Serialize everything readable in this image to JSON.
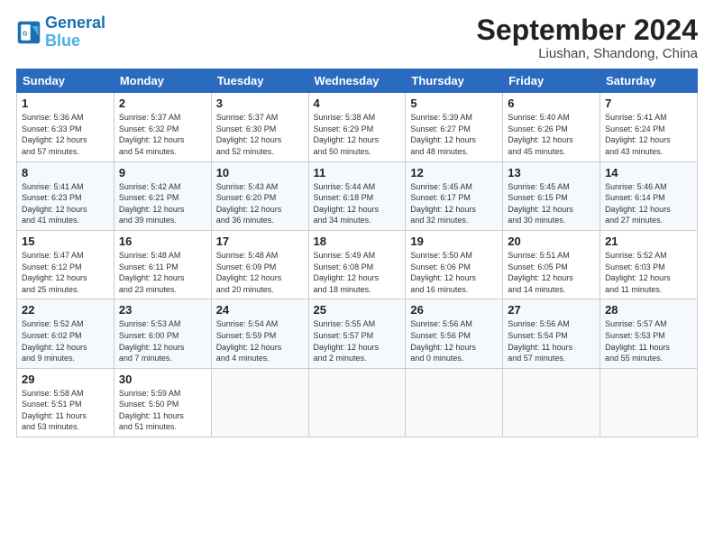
{
  "logo": {
    "line1": "General",
    "line2": "Blue"
  },
  "title": "September 2024",
  "location": "Liushan, Shandong, China",
  "days_of_week": [
    "Sunday",
    "Monday",
    "Tuesday",
    "Wednesday",
    "Thursday",
    "Friday",
    "Saturday"
  ],
  "weeks": [
    [
      {
        "num": "1",
        "rise": "5:36 AM",
        "set": "6:33 PM",
        "hours": "12 hours",
        "mins": "57"
      },
      {
        "num": "2",
        "rise": "5:37 AM",
        "set": "6:32 PM",
        "hours": "12 hours",
        "mins": "54"
      },
      {
        "num": "3",
        "rise": "5:37 AM",
        "set": "6:30 PM",
        "hours": "12 hours",
        "mins": "52"
      },
      {
        "num": "4",
        "rise": "5:38 AM",
        "set": "6:29 PM",
        "hours": "12 hours",
        "mins": "50"
      },
      {
        "num": "5",
        "rise": "5:39 AM",
        "set": "6:27 PM",
        "hours": "12 hours",
        "mins": "48"
      },
      {
        "num": "6",
        "rise": "5:40 AM",
        "set": "6:26 PM",
        "hours": "12 hours",
        "mins": "45"
      },
      {
        "num": "7",
        "rise": "5:41 AM",
        "set": "6:24 PM",
        "hours": "12 hours",
        "mins": "43"
      }
    ],
    [
      {
        "num": "8",
        "rise": "5:41 AM",
        "set": "6:23 PM",
        "hours": "12 hours",
        "mins": "41"
      },
      {
        "num": "9",
        "rise": "5:42 AM",
        "set": "6:21 PM",
        "hours": "12 hours",
        "mins": "39"
      },
      {
        "num": "10",
        "rise": "5:43 AM",
        "set": "6:20 PM",
        "hours": "12 hours",
        "mins": "36"
      },
      {
        "num": "11",
        "rise": "5:44 AM",
        "set": "6:18 PM",
        "hours": "12 hours",
        "mins": "34"
      },
      {
        "num": "12",
        "rise": "5:45 AM",
        "set": "6:17 PM",
        "hours": "12 hours",
        "mins": "32"
      },
      {
        "num": "13",
        "rise": "5:45 AM",
        "set": "6:15 PM",
        "hours": "12 hours",
        "mins": "30"
      },
      {
        "num": "14",
        "rise": "5:46 AM",
        "set": "6:14 PM",
        "hours": "12 hours",
        "mins": "27"
      }
    ],
    [
      {
        "num": "15",
        "rise": "5:47 AM",
        "set": "6:12 PM",
        "hours": "12 hours",
        "mins": "25"
      },
      {
        "num": "16",
        "rise": "5:48 AM",
        "set": "6:11 PM",
        "hours": "12 hours",
        "mins": "23"
      },
      {
        "num": "17",
        "rise": "5:48 AM",
        "set": "6:09 PM",
        "hours": "12 hours",
        "mins": "20"
      },
      {
        "num": "18",
        "rise": "5:49 AM",
        "set": "6:08 PM",
        "hours": "12 hours",
        "mins": "18"
      },
      {
        "num": "19",
        "rise": "5:50 AM",
        "set": "6:06 PM",
        "hours": "12 hours",
        "mins": "16"
      },
      {
        "num": "20",
        "rise": "5:51 AM",
        "set": "6:05 PM",
        "hours": "12 hours",
        "mins": "14"
      },
      {
        "num": "21",
        "rise": "5:52 AM",
        "set": "6:03 PM",
        "hours": "12 hours",
        "mins": "11"
      }
    ],
    [
      {
        "num": "22",
        "rise": "5:52 AM",
        "set": "6:02 PM",
        "hours": "12 hours",
        "mins": "9"
      },
      {
        "num": "23",
        "rise": "5:53 AM",
        "set": "6:00 PM",
        "hours": "12 hours",
        "mins": "7"
      },
      {
        "num": "24",
        "rise": "5:54 AM",
        "set": "5:59 PM",
        "hours": "12 hours",
        "mins": "4"
      },
      {
        "num": "25",
        "rise": "5:55 AM",
        "set": "5:57 PM",
        "hours": "12 hours",
        "mins": "2"
      },
      {
        "num": "26",
        "rise": "5:56 AM",
        "set": "5:56 PM",
        "hours": "12 hours",
        "mins": "0"
      },
      {
        "num": "27",
        "rise": "5:56 AM",
        "set": "5:54 PM",
        "hours": "11 hours",
        "mins": "57"
      },
      {
        "num": "28",
        "rise": "5:57 AM",
        "set": "5:53 PM",
        "hours": "11 hours",
        "mins": "55"
      }
    ],
    [
      {
        "num": "29",
        "rise": "5:58 AM",
        "set": "5:51 PM",
        "hours": "11 hours",
        "mins": "53"
      },
      {
        "num": "30",
        "rise": "5:59 AM",
        "set": "5:50 PM",
        "hours": "11 hours",
        "mins": "51"
      },
      null,
      null,
      null,
      null,
      null
    ]
  ]
}
